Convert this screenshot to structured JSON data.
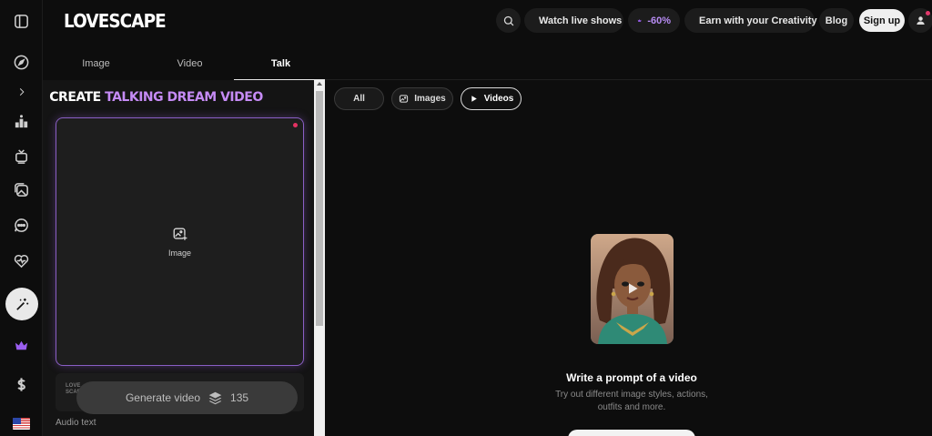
{
  "app": {
    "logo": "LOVESCAPE"
  },
  "header": {
    "watch_live": "Watch live shows",
    "discount": "-60%",
    "earn": "Earn with your Creativity",
    "blog": "Blog",
    "signup": "Sign up"
  },
  "tabs": [
    {
      "label": "Image"
    },
    {
      "label": "Video"
    },
    {
      "label": "Talk"
    }
  ],
  "panel": {
    "title_prefix": "CREATE ",
    "title_accent": "TALKING DREAM VIDEO",
    "upload_label": "Image",
    "logo_mark_line1": "LOVE",
    "logo_mark_line2": "SCAP",
    "generate_label": "Generate video",
    "generate_cost": "135",
    "audio_label": "Audio text"
  },
  "filters": [
    {
      "label": "All"
    },
    {
      "label": "Images"
    },
    {
      "label": "Videos"
    }
  ],
  "empty_state": {
    "title": "Write a prompt of a video",
    "subtitle_line1": "Try out different image styles, actions,",
    "subtitle_line2": "outfits and more."
  },
  "colors": {
    "accent": "#c58bf5",
    "background": "#0d0d0d",
    "panel": "#141414",
    "live_dot": "#1f8a4c",
    "notify_dot": "#e33262"
  }
}
